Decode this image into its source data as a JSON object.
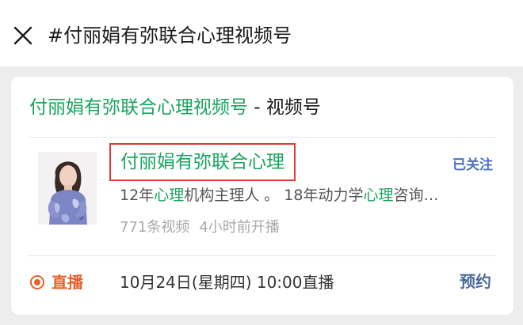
{
  "header": {
    "close_icon": "close-icon",
    "search_query": "#付丽娟有弥联合心理视频号"
  },
  "result_card": {
    "title_name": "付丽娟有弥联合心理视频号",
    "title_suffix": " - 视频号",
    "account": {
      "avatar_icon": "avatar",
      "name": "付丽娟有弥联合心理",
      "follow_status": "已关注",
      "bio_parts": [
        "12年",
        "心理",
        "机构主理人 。 18年动力学",
        "心理",
        "咨询…"
      ],
      "video_count": "771条视频",
      "last_live": "4小时前开播"
    },
    "live": {
      "icon": "live-dot-icon",
      "label": "直播",
      "schedule": "10月24日(星期四) 10:00直播",
      "reserve_label": "预约"
    }
  },
  "colors": {
    "accent_green": "#1aa55f",
    "live_orange": "#e8602c",
    "link_blue": "#4a70c0",
    "highlight_border": "#e53935"
  }
}
